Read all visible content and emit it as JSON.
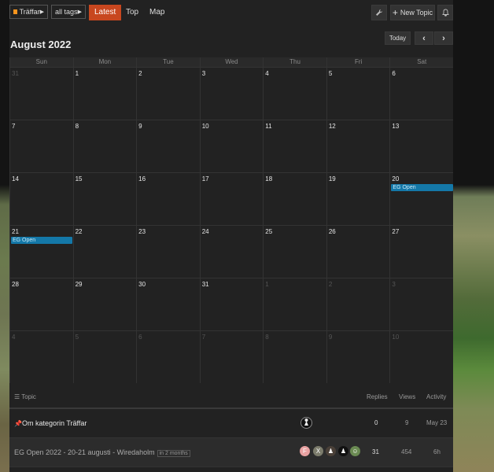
{
  "nav": {
    "category": "Träffar",
    "tags": "all tags",
    "links": [
      "Latest",
      "Top",
      "Map"
    ],
    "new_topic": "New Topic"
  },
  "calendar": {
    "month_title": "August 2022",
    "today_label": "Today",
    "weekdays": [
      "Sun",
      "Mon",
      "Tue",
      "Wed",
      "Thu",
      "Fri",
      "Sat"
    ],
    "weeks": [
      [
        {
          "d": "31",
          "o": true
        },
        {
          "d": "1"
        },
        {
          "d": "2"
        },
        {
          "d": "3"
        },
        {
          "d": "4"
        },
        {
          "d": "5"
        },
        {
          "d": "6"
        }
      ],
      [
        {
          "d": "7"
        },
        {
          "d": "8"
        },
        {
          "d": "9"
        },
        {
          "d": "10"
        },
        {
          "d": "11"
        },
        {
          "d": "12"
        },
        {
          "d": "13"
        }
      ],
      [
        {
          "d": "14"
        },
        {
          "d": "15"
        },
        {
          "d": "16"
        },
        {
          "d": "17"
        },
        {
          "d": "18"
        },
        {
          "d": "19"
        },
        {
          "d": "20"
        }
      ],
      [
        {
          "d": "21"
        },
        {
          "d": "22"
        },
        {
          "d": "23"
        },
        {
          "d": "24"
        },
        {
          "d": "25"
        },
        {
          "d": "26"
        },
        {
          "d": "27"
        }
      ],
      [
        {
          "d": "28"
        },
        {
          "d": "29"
        },
        {
          "d": "30"
        },
        {
          "d": "31"
        },
        {
          "d": "1",
          "o": true
        },
        {
          "d": "2",
          "o": true
        },
        {
          "d": "3",
          "o": true
        }
      ],
      [
        {
          "d": "4",
          "o": true
        },
        {
          "d": "5",
          "o": true
        },
        {
          "d": "6",
          "o": true
        },
        {
          "d": "7",
          "o": true
        },
        {
          "d": "8",
          "o": true
        },
        {
          "d": "9",
          "o": true
        },
        {
          "d": "10",
          "o": true
        }
      ]
    ],
    "event_label": "EG Open"
  },
  "list": {
    "headers": {
      "topic": "Topic",
      "replies": "Replies",
      "views": "Views",
      "activity": "Activity"
    },
    "rows": [
      {
        "title": "Om kategorin Träffar",
        "replies": "0",
        "views": "9",
        "activity": "May 23"
      },
      {
        "title": "EG Open 2022 - 20-21 augusti - Wiredaholm",
        "badge": "in 2 months",
        "replies": "31",
        "views": "454",
        "activity": "6h"
      }
    ],
    "avatar_letters": [
      "F",
      "X"
    ]
  },
  "colors": {
    "accent": "#c8471f",
    "category": "#f7941d",
    "event": "#1478a8"
  }
}
